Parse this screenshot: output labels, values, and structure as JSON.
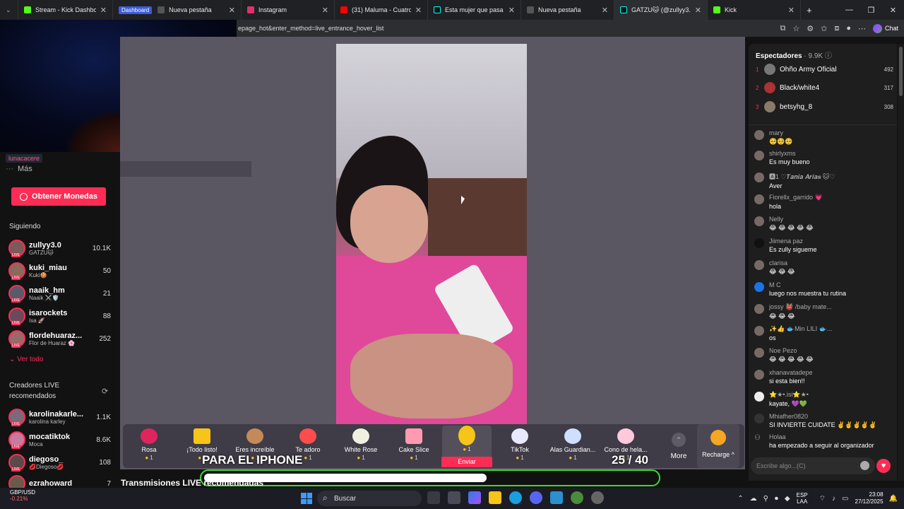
{
  "browser": {
    "tabs": [
      {
        "label": "Stream - Kick Dashboard",
        "badge": "Dashboard",
        "color": "#53fc18",
        "active": false
      },
      {
        "label": "Nueva pestaña",
        "color": "#666666",
        "active": false
      },
      {
        "label": "Instagram",
        "color": "#e1306c",
        "active": false
      },
      {
        "label": "(31) Maluma - Cuatro",
        "color": "#ff0000",
        "active": false
      },
      {
        "label": "Esta mujer que pasa los 30",
        "color": "#111111",
        "active": false
      },
      {
        "label": "Nueva pestaña",
        "color": "#666666",
        "active": false
      },
      {
        "label": "GATZU🐱 (@zullyy3.0) es",
        "color": "#111111",
        "active": true
      },
      {
        "label": "Kick",
        "color": "#53fc18",
        "active": false
      }
    ],
    "url": "epage_hot&enter_method=live_entrance_hover_list",
    "chat_button": "Chat"
  },
  "sidebar": {
    "overlay_tag": "lunacacere",
    "more": "Más",
    "get_coins": "Obtener Monedas",
    "following_heading": "Siguiendo",
    "following": [
      {
        "name": "zullyy3.0",
        "sub": "GATZU🐱",
        "count": "10.1K"
      },
      {
        "name": "kuki_miau",
        "sub": "Kuki🍪",
        "count": "50"
      },
      {
        "name": "naaik_hm",
        "sub": "Naaik ⚔️🛡️",
        "count": "21"
      },
      {
        "name": "isarockets",
        "sub": "Isa 🚀",
        "count": "88"
      },
      {
        "name": "flordehuaraz...",
        "sub": "Flor de Huaraz 🌸",
        "count": "252"
      }
    ],
    "see_all": "Ver todo",
    "recommended_heading": "Creadores LIVE recomendados",
    "recommended": [
      {
        "name": "karolinakarle...",
        "sub": "karolina karley",
        "count": "1.1K"
      },
      {
        "name": "mocatiktok",
        "sub": "Moca",
        "count": "8.6K"
      },
      {
        "name": "diegoso_",
        "sub": "💋Diegoso💋",
        "count": "108"
      },
      {
        "name": "ezrahoward",
        "sub": "",
        "count": "7"
      }
    ]
  },
  "gifts": [
    {
      "name": "Rosa",
      "price": "1",
      "color": "#e0245e"
    },
    {
      "name": "¡Todo listo!",
      "price": "1",
      "color": "#f5c518"
    },
    {
      "name": "Eres increíble",
      "price": "1",
      "color": "#c48a5a"
    },
    {
      "name": "Te adoro",
      "price": "1",
      "color": "#ff4d4d"
    },
    {
      "name": "White Rose",
      "price": "1",
      "color": "#f0f0e0"
    },
    {
      "name": "Cake Slice",
      "price": "1",
      "color": "#ff9ab0"
    },
    {
      "name": "",
      "price": "1",
      "color": "#f5c518"
    },
    {
      "name": "TikTok",
      "price": "1",
      "color": "#e8e8ff"
    },
    {
      "name": "Alas Guardian...",
      "price": "1",
      "color": "#cde0ff"
    },
    {
      "name": "Cono de hela...",
      "price": "1",
      "color": "#ffc8dd"
    }
  ],
  "send_label": "Enviar",
  "more_label": "More",
  "recharge_label": "Recharge ^",
  "overlay_text": "PARA EL IPHONE",
  "goal_counter": "25 / 40",
  "goal_progress": 0.625,
  "transmisiones": "Transmisiones LIVE recomendadas",
  "chat": {
    "viewers_label": "Espectadores",
    "viewers_count": "· 9.9K",
    "top_viewers": [
      {
        "rank": "1",
        "name": "Ohño Army Oficial",
        "score": "492"
      },
      {
        "rank": "2",
        "name": "Black/white4",
        "score": "317"
      },
      {
        "rank": "3",
        "name": "betsyhg_8",
        "score": "308"
      }
    ],
    "messages": [
      {
        "user": "mary",
        "text": "🥺🥺🥺"
      },
      {
        "user": "shirlyxms",
        "text": "Es muy bueno"
      },
      {
        "user": "🅰1 ♡𝑻𝒂𝒏𝒊𝒂 𝑨𝒓𝒊𝒂𝒔 🐱♡",
        "text": "Aver"
      },
      {
        "user": "Fiorellx_garrido 💗",
        "text": "hola"
      },
      {
        "user": "Nelly",
        "text": "😂 😂 😂 😂 😂"
      },
      {
        "user": "Jiimena paz",
        "text": "Es zully sigueme"
      },
      {
        "user": "clarisa",
        "text": "😂 😂 😂"
      },
      {
        "user": "M C",
        "text": "luego nos muestra tu rutina"
      },
      {
        "user": "jossy 👹 /baby mate...",
        "text": "😂 😂 😂"
      },
      {
        "user": "✨👍 🐟Min LILI 🐟...",
        "text": "os"
      },
      {
        "user": "Noe Pezo",
        "text": "😂 😂 😂 😂 😂"
      },
      {
        "user": "xhanavatadepe",
        "text": "si esta bien!!"
      },
      {
        "user": "⭐★•.isi⭐★•",
        "text": "kayate, 💜💚"
      },
      {
        "user": "Mhiafher0820",
        "text": "SI INVIERTE CUIDATE ✌️✌️✌️✌️✌️"
      },
      {
        "user": "Holaa",
        "text": "ha empezado a seguir al organizador"
      }
    ],
    "input_placeholder": "Escribe algo...(C)"
  },
  "taskbar": {
    "ticker_pair": "GBP/USD",
    "ticker_value": "-0.21%",
    "search": "Buscar",
    "lang_top": "ESP",
    "lang_bottom": "LAA",
    "time": "23:08",
    "date": "27/12/2025"
  }
}
